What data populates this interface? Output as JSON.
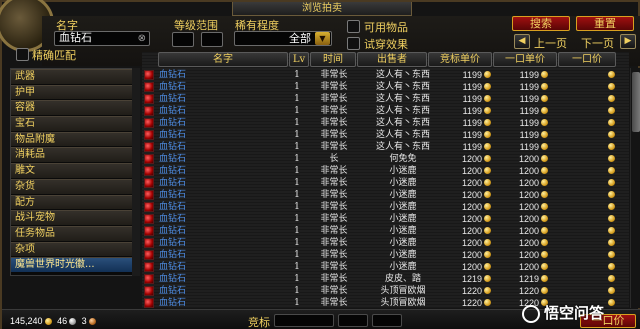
{
  "window": {
    "title": "浏览拍卖"
  },
  "filters": {
    "name_label": "名字",
    "name_value": "血钻石",
    "level_label": "等级范围",
    "rarity_label": "稀有程度",
    "rarity_value": "全部",
    "exact_match_label": "精确匹配",
    "usable_label": "可用物品",
    "preview_label": "试穿效果",
    "search_button": "搜索",
    "reset_button": "重置",
    "prev_page": "上一页",
    "next_page": "下一页"
  },
  "categories": [
    {
      "label": "武器",
      "selected": false
    },
    {
      "label": "护甲",
      "selected": false
    },
    {
      "label": "容器",
      "selected": false
    },
    {
      "label": "宝石",
      "selected": false
    },
    {
      "label": "物品附魔",
      "selected": false
    },
    {
      "label": "消耗品",
      "selected": false
    },
    {
      "label": "雕文",
      "selected": false
    },
    {
      "label": "杂货",
      "selected": false
    },
    {
      "label": "配方",
      "selected": false
    },
    {
      "label": "战斗宠物",
      "selected": false
    },
    {
      "label": "任务物品",
      "selected": false
    },
    {
      "label": "杂项",
      "selected": false
    },
    {
      "label": "魔兽世界时光徽...",
      "selected": true
    }
  ],
  "columns": {
    "name": "名字",
    "lv": "Lv",
    "time": "时间",
    "seller": "出售者",
    "bid": "竞标单价",
    "buyout": "一口单价",
    "buyout_total": "一口价"
  },
  "rows": [
    {
      "name": "血钻石",
      "lv": "1",
      "time": "非常长",
      "seller": "这人有丶东西",
      "bid": "1199",
      "buyout": "1199"
    },
    {
      "name": "血钻石",
      "lv": "1",
      "time": "非常长",
      "seller": "这人有丶东西",
      "bid": "1199",
      "buyout": "1199"
    },
    {
      "name": "血钻石",
      "lv": "1",
      "time": "非常长",
      "seller": "这人有丶东西",
      "bid": "1199",
      "buyout": "1199"
    },
    {
      "name": "血钻石",
      "lv": "1",
      "time": "非常长",
      "seller": "这人有丶东西",
      "bid": "1199",
      "buyout": "1199"
    },
    {
      "name": "血钻石",
      "lv": "1",
      "time": "非常长",
      "seller": "这人有丶东西",
      "bid": "1199",
      "buyout": "1199"
    },
    {
      "name": "血钻石",
      "lv": "1",
      "time": "非常长",
      "seller": "这人有丶东西",
      "bid": "1199",
      "buyout": "1199"
    },
    {
      "name": "血钻石",
      "lv": "1",
      "time": "非常长",
      "seller": "这人有丶东西",
      "bid": "1199",
      "buyout": "1199"
    },
    {
      "name": "血钻石",
      "lv": "1",
      "time": "长",
      "seller": "何免免",
      "bid": "1200",
      "buyout": "1200"
    },
    {
      "name": "血钻石",
      "lv": "1",
      "time": "非常长",
      "seller": "小迷鹿",
      "bid": "1200",
      "buyout": "1200"
    },
    {
      "name": "血钻石",
      "lv": "1",
      "time": "非常长",
      "seller": "小迷鹿",
      "bid": "1200",
      "buyout": "1200"
    },
    {
      "name": "血钻石",
      "lv": "1",
      "time": "非常长",
      "seller": "小迷鹿",
      "bid": "1200",
      "buyout": "1200"
    },
    {
      "name": "血钻石",
      "lv": "1",
      "time": "非常长",
      "seller": "小迷鹿",
      "bid": "1200",
      "buyout": "1200"
    },
    {
      "name": "血钻石",
      "lv": "1",
      "time": "非常长",
      "seller": "小迷鹿",
      "bid": "1200",
      "buyout": "1200"
    },
    {
      "name": "血钻石",
      "lv": "1",
      "time": "非常长",
      "seller": "小迷鹿",
      "bid": "1200",
      "buyout": "1200"
    },
    {
      "name": "血钻石",
      "lv": "1",
      "time": "非常长",
      "seller": "小迷鹿",
      "bid": "1200",
      "buyout": "1200"
    },
    {
      "name": "血钻石",
      "lv": "1",
      "time": "非常长",
      "seller": "小迷鹿",
      "bid": "1200",
      "buyout": "1200"
    },
    {
      "name": "血钻石",
      "lv": "1",
      "time": "非常长",
      "seller": "小迷鹿",
      "bid": "1200",
      "buyout": "1200"
    },
    {
      "name": "血钻石",
      "lv": "1",
      "time": "非常长",
      "seller": "皮皮、踏",
      "bid": "1219",
      "buyout": "1219"
    },
    {
      "name": "血钻石",
      "lv": "1",
      "time": "非常长",
      "seller": "头顶冒欧烟",
      "bid": "1220",
      "buyout": "1220"
    },
    {
      "name": "血钻石",
      "lv": "1",
      "time": "非常长",
      "seller": "头顶冒欧烟",
      "bid": "1220",
      "buyout": "1220"
    }
  ],
  "footer": {
    "gold": "145,240",
    "silver": "46",
    "copper": "3",
    "bid_label": "竞标",
    "buyout_button": "一口价"
  },
  "watermark": "悟空问答"
}
